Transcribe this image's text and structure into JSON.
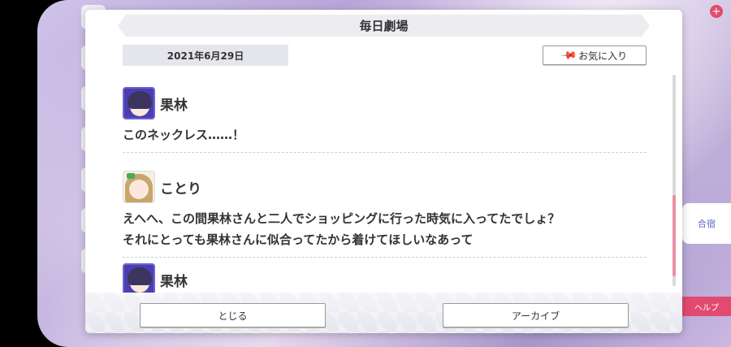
{
  "dialog": {
    "title": "毎日劇場",
    "date": "2021年6月29日",
    "favorite_label": "お気に入り",
    "close_label": "とじる",
    "archive_label": "アーカイブ"
  },
  "entries": [
    {
      "speaker": "果林",
      "lines": [
        "このネックレス……！"
      ]
    },
    {
      "speaker": "ことり",
      "lines": [
        "えへへ、この間果林さんと二人でショッピングに行った時気に入ってたでしょ？",
        "それにとっても果林さんに似合ってたから着けてほしいなあって"
      ]
    },
    {
      "speaker": "果林",
      "lines": []
    }
  ],
  "background": {
    "right_label_1": "合宿",
    "right_label_2": "ヘルプ",
    "badge": "+"
  },
  "colors": {
    "accent_pink": "#ea8ea2",
    "avatar_purple": "#4b3fb0"
  }
}
